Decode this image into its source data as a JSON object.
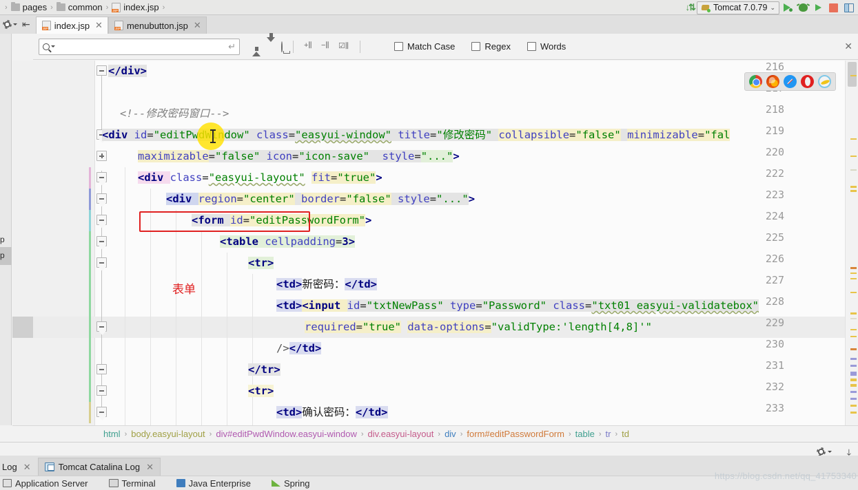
{
  "nav": {
    "items": [
      {
        "label": "pages",
        "icon": "folder-icon"
      },
      {
        "label": "common",
        "icon": "folder-icon"
      },
      {
        "label": "index.jsp",
        "icon": "jsp-file-icon"
      }
    ],
    "separator": "›"
  },
  "run_config": {
    "name": "Tomcat 7.0.79",
    "chevron": "⌄",
    "buttons": [
      "run-button",
      "debug-button",
      "run-with-coverage-button",
      "stop-button",
      "layout-button"
    ]
  },
  "tabs": [
    {
      "label": "index.jsp",
      "active": true,
      "close": "✕"
    },
    {
      "label": "menubutton.jsp",
      "active": false,
      "close": "✕"
    }
  ],
  "find_bar": {
    "placeholder": "",
    "value": "",
    "enter_glyph": "↵",
    "checkboxes": [
      {
        "label": "Match Case",
        "checked": false
      },
      {
        "label": "Regex",
        "checked": false
      },
      {
        "label": "Words",
        "checked": false
      }
    ],
    "close": "✕"
  },
  "left_stripe_labels": [
    "p",
    "p"
  ],
  "editor": {
    "first_line": 216,
    "line_numbers": [
      216,
      217,
      218,
      219,
      220,
      222,
      223,
      224,
      225,
      226,
      227,
      228,
      229,
      230,
      231,
      232,
      233
    ],
    "lines": [
      {
        "num": "216",
        "text": "</div>"
      },
      {
        "num": "217",
        "text": ""
      },
      {
        "num": "218",
        "text": "<!--修改密码窗口-->"
      },
      {
        "num": "219",
        "text": "<div id=\"editPwdWindow\" class=\"easyui-window\" title=\"修改密码\" collapsible=\"false\" minimizable=\"fal"
      },
      {
        "num": "220",
        "text": "    maximizable=\"false\" icon=\"icon-save\"  style=\"...\">"
      },
      {
        "num": "222",
        "text": "  <div class=\"easyui-layout\" fit=\"true\">"
      },
      {
        "num": "223",
        "text": "    <div region=\"center\" border=\"false\" style=\"...\">"
      },
      {
        "num": "224",
        "text": "      <form id=\"editPasswordForm\">"
      },
      {
        "num": "225",
        "text": "        <table cellpadding=3>"
      },
      {
        "num": "226",
        "text": "          <tr>"
      },
      {
        "num": "227",
        "text": "            <td>新密码：</td>"
      },
      {
        "num": "228",
        "text": "            <td><input id=\"txtNewPass\" type=\"Password\" class=\"txt01 easyui-validatebox\""
      },
      {
        "num": "229",
        "text": "                required=\"true\" data-options=\"validType:'length[4,8]'\""
      },
      {
        "num": "230",
        "text": "            /></td>"
      },
      {
        "num": "231",
        "text": "          </tr>"
      },
      {
        "num": "232",
        "text": "          <tr>"
      },
      {
        "num": "233",
        "text": "            <td>确认密码：</td>"
      }
    ],
    "annotations": [
      {
        "type": "box",
        "target": "id=\"editPasswordForm\""
      },
      {
        "type": "text",
        "label": "表单"
      }
    ],
    "cursor_word": "class"
  },
  "browser_popup": {
    "icons": [
      "chrome-icon",
      "firefox-icon",
      "safari-icon",
      "opera-icon",
      "ie-icon"
    ]
  },
  "breadcrumb": {
    "separator": "›",
    "items": [
      {
        "label": "html",
        "color": "#3f9f8f"
      },
      {
        "label": "body.easyui-layout",
        "color": "#a0a045"
      },
      {
        "label": "div#editPwdWindow.easyui-window",
        "color": "#b05ab0"
      },
      {
        "label": "div.easyui-layout",
        "color": "#c45a8a"
      },
      {
        "label": "div",
        "color": "#3f7fbf"
      },
      {
        "label": "form#editPasswordForm",
        "color": "#d07a3a"
      },
      {
        "label": "table",
        "color": "#3f9f8f"
      },
      {
        "label": "tr",
        "color": "#7a7ac8"
      },
      {
        "label": "td",
        "color": "#a0a045"
      }
    ]
  },
  "tool_window_tabs": [
    {
      "label": "Log",
      "close": "✕",
      "icon": null
    },
    {
      "label": "Tomcat Catalina Log",
      "close": "✕",
      "icon": "catalina-log-icon"
    }
  ],
  "bottom_bar_items": [
    {
      "label": "Application Server",
      "icon": "server-icon"
    },
    {
      "label": "Terminal",
      "icon": "terminal-icon"
    },
    {
      "label": "Java Enterprise",
      "icon": "java-enterprise-icon"
    },
    {
      "label": "Spring",
      "icon": "spring-icon"
    }
  ],
  "watermark": "https://blog.csdn.net/qq_41753340",
  "colors": {
    "accent_green": "#4caf50",
    "error_red": "#cc3b3b",
    "annotation_red": "#e02020",
    "tag": "#000080",
    "attr": "#4040c0",
    "value": "#008000",
    "comment": "#808080"
  }
}
